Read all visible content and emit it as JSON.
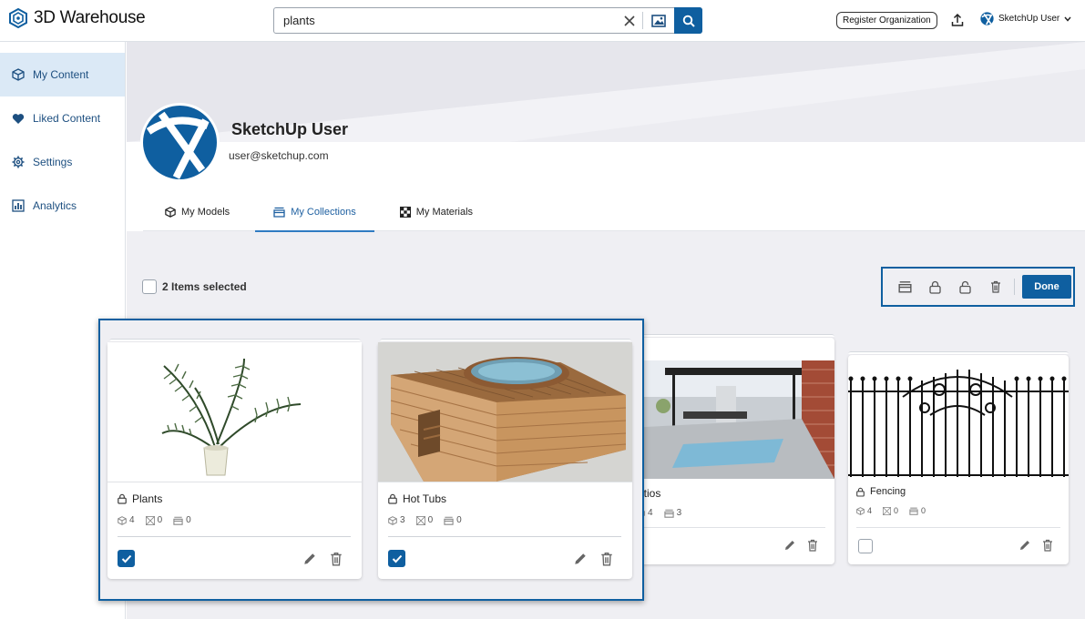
{
  "app": {
    "name": "3D Warehouse"
  },
  "search": {
    "value": "plants"
  },
  "header": {
    "register_label": "Register Organization",
    "user_label": "SketchUp User"
  },
  "sidebar": {
    "items": [
      {
        "label": "My Content",
        "icon": "cube-icon",
        "active": true
      },
      {
        "label": "Liked Content",
        "icon": "heart-icon",
        "active": false
      },
      {
        "label": "Settings",
        "icon": "gear-icon",
        "active": false
      },
      {
        "label": "Analytics",
        "icon": "bar-chart-icon",
        "active": false
      }
    ]
  },
  "profile": {
    "name": "SketchUp User",
    "email": "user@sketchup.com"
  },
  "tabs": [
    {
      "label": "My Models",
      "icon": "cube-icon",
      "active": false
    },
    {
      "label": "My Collections",
      "icon": "collection-icon",
      "active": true
    },
    {
      "label": "My Materials",
      "icon": "material-icon",
      "active": false
    }
  ],
  "selection": {
    "label": "2 Items selected"
  },
  "toolbar": {
    "done_label": "Done"
  },
  "collections": [
    {
      "title": "Plants",
      "models": "4",
      "materials": "0",
      "collections": "0",
      "checked": true
    },
    {
      "title": "Hot Tubs",
      "models": "3",
      "materials": "0",
      "collections": "0",
      "checked": true
    },
    {
      "title": "atios",
      "models": "4",
      "materials": "",
      "collections": "3",
      "checked": false
    },
    {
      "title": "Fencing",
      "models": "4",
      "materials": "0",
      "collections": "0",
      "checked": false
    }
  ],
  "colors": {
    "primary": "#0f5fa0",
    "sidebar_active": "#dbe9f6",
    "background": "#efeff3"
  }
}
